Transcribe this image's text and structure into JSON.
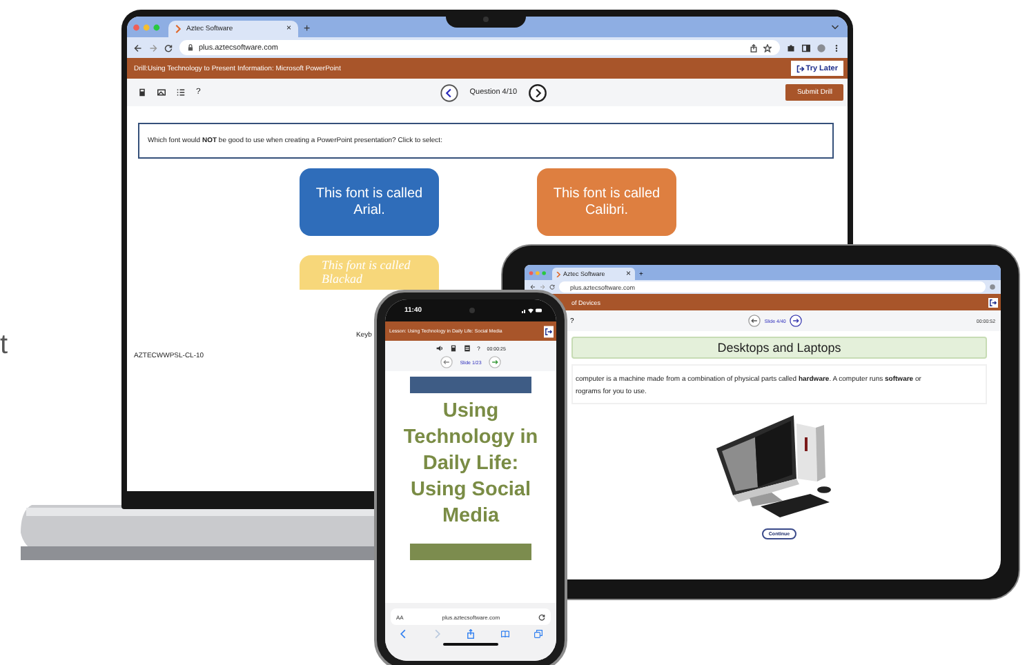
{
  "background_text": "t",
  "laptop": {
    "browser": {
      "tab_title": "Aztec Software",
      "tab_close": "×",
      "new_tab": "+",
      "url": "plus.aztecsoftware.com"
    },
    "header": {
      "title": "Drill:Using Technology to Present Information: Microsoft PowerPoint",
      "button": "Try Later"
    },
    "toolbar": {
      "help": "?",
      "question": "Question 4/10",
      "submit": "Submit Drill"
    },
    "prompt": "Which font would **NOT** be good to use when creating a PowerPoint presentation? Click to select:",
    "choices": [
      {
        "text": "This font is called Arial.",
        "color": "#2f6dba",
        "kind": "sans"
      },
      {
        "text": "This font is called Calibri.",
        "color": "#de7f40",
        "kind": "sans"
      },
      {
        "text": "This font is called Blackad",
        "color": "#f7d77a",
        "kind": "script"
      }
    ],
    "keyboard_text": "Keyb",
    "footer_code": "AZTECWWPSL-CL-10"
  },
  "tablet": {
    "browser": {
      "tab_title": "Aztec Software",
      "tab_close": "×",
      "new_tab": "+",
      "url": "plus.aztecsoftware.com"
    },
    "header": {
      "title": "of Devices"
    },
    "toolbar": {
      "help": "?",
      "slide": "Slide 4/40",
      "timer": "00:00:52"
    },
    "heading": "Desktops and Laptops",
    "paragraph_lines": [
      "computer is a machine made from a combination of physical parts called **hardware**. A computer runs **software** or",
      "rograms for you to use."
    ],
    "continue": "Continue"
  },
  "phone": {
    "status_time": "11:40",
    "header": {
      "title": "Lesson: Using Technology in Daily Life: Social Media"
    },
    "toolbar": {
      "help": "?",
      "timer": "00:00:25",
      "slide": "Slide 1/23"
    },
    "title": "Using Technology in Daily Life: Using Social Media",
    "browser": {
      "text_size": "AA",
      "url": "plus.aztecsoftware.com"
    }
  }
}
